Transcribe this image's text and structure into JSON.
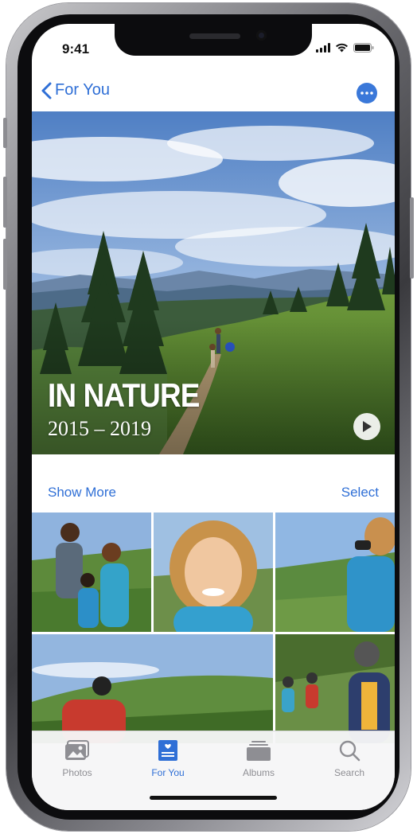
{
  "status_bar": {
    "time": "9:41"
  },
  "nav": {
    "back_label": "For You"
  },
  "hero": {
    "title": "IN NATURE",
    "years": "2015 – 2019"
  },
  "section": {
    "show_more": "Show More",
    "select": "Select"
  },
  "tabs": [
    {
      "label": "Photos",
      "icon": "photos-icon",
      "active": false
    },
    {
      "label": "For You",
      "icon": "for-you-icon",
      "active": true
    },
    {
      "label": "Albums",
      "icon": "albums-icon",
      "active": false
    },
    {
      "label": "Search",
      "icon": "search-icon",
      "active": false
    }
  ],
  "colors": {
    "accent": "#2f6fd6",
    "inactive": "#8e8e93"
  }
}
